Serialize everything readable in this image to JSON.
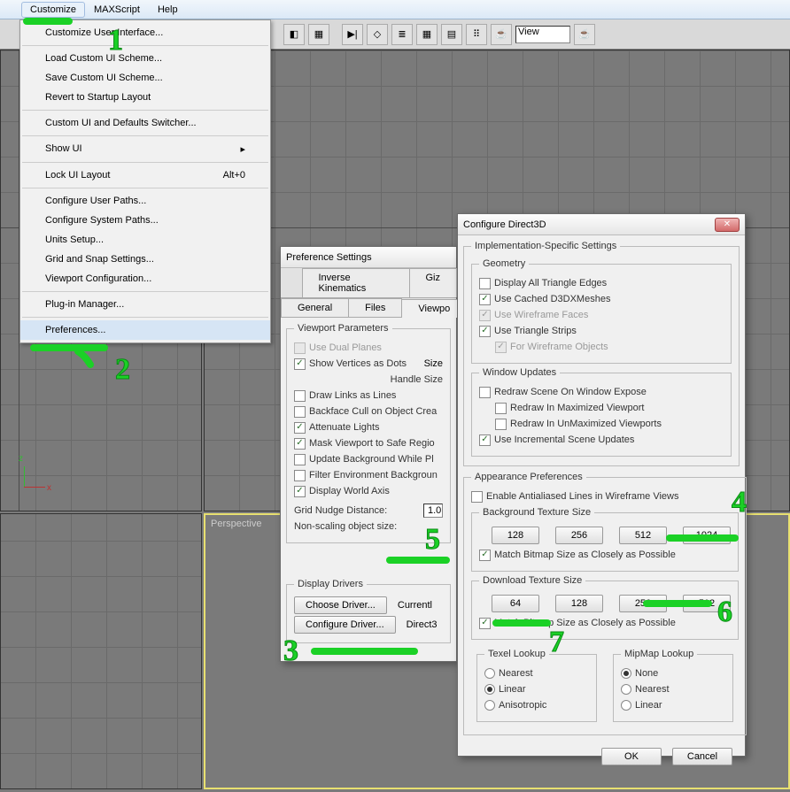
{
  "menubar": {
    "items": [
      "Customize",
      "MAXScript",
      "Help"
    ],
    "open_index": 0
  },
  "toolbar": {
    "view_label": "View"
  },
  "dropdown": {
    "groups": [
      [
        "Customize User Interface..."
      ],
      [
        "Load Custom UI Scheme...",
        "Save Custom UI Scheme...",
        "Revert to Startup Layout"
      ],
      [
        "Custom UI and Defaults Switcher..."
      ],
      [
        "Show UI"
      ],
      [
        "Lock UI Layout"
      ],
      [
        "Configure User Paths...",
        "Configure System Paths...",
        "Units Setup...",
        "Grid and Snap Settings...",
        "Viewport Configuration..."
      ],
      [
        "Plug-in Manager..."
      ],
      [
        "Preferences..."
      ]
    ],
    "show_ui_has_arrow": true,
    "lock_shortcut": "Alt+0",
    "highlight": "Preferences..."
  },
  "viewports": {
    "perspective": "Perspective"
  },
  "pref": {
    "title": "Preference Settings",
    "tabs_row1": [
      "Inverse Kinematics",
      "Giz"
    ],
    "tabs_row2": [
      "General",
      "Files",
      "Viewpo"
    ],
    "vp_params": {
      "legend": "Viewport Parameters",
      "items": [
        {
          "label": "Use Dual Planes",
          "checked": false,
          "disabled": true
        },
        {
          "label": "Show Vertices as Dots",
          "checked": true,
          "extra": "Size"
        },
        {
          "label": "",
          "sub": "Handle Size"
        },
        {
          "label": "Draw Links as Lines",
          "checked": false
        },
        {
          "label": "Backface Cull on Object Crea",
          "checked": false
        },
        {
          "label": "Attenuate Lights",
          "checked": true
        },
        {
          "label": "Mask Viewport to Safe Regio",
          "checked": true
        },
        {
          "label": "Update Background While Pl",
          "checked": false
        },
        {
          "label": "Filter Environment Backgroun",
          "checked": false
        },
        {
          "label": "Display World Axis",
          "checked": true
        }
      ],
      "grid_nudge": "Grid Nudge Distance:",
      "grid_val": "1.0",
      "nonscale": "Non-scaling object size:"
    },
    "drivers": {
      "legend": "Display Drivers",
      "choose": "Choose Driver...",
      "currently": "Currentl",
      "configure": "Configure Driver...",
      "type": "Direct3"
    }
  },
  "d3d": {
    "title": "Configure Direct3D",
    "impl": "Implementation-Specific Settings",
    "geom": {
      "legend": "Geometry",
      "items": [
        {
          "label": "Display All Triangle Edges",
          "checked": false
        },
        {
          "label": "Use Cached D3DXMeshes",
          "checked": true
        },
        {
          "label": "Use Wireframe Faces",
          "checked": true,
          "disabled": true
        },
        {
          "label": "Use Triangle Strips",
          "checked": true
        },
        {
          "label": "For Wireframe Objects",
          "checked": true,
          "disabled": true,
          "indent": true
        }
      ]
    },
    "win": {
      "legend": "Window Updates",
      "items": [
        {
          "label": "Redraw Scene On Window Expose",
          "checked": false
        },
        {
          "label": "Redraw In Maximized Viewport",
          "checked": false,
          "indent": true
        },
        {
          "label": "Redraw In UnMaximized Viewports",
          "checked": false,
          "indent": true
        },
        {
          "label": "Use Incremental Scene Updates",
          "checked": true
        }
      ]
    },
    "appear": {
      "legend": "Appearance Preferences",
      "antialias": {
        "label": "Enable Antialiased Lines in Wireframe Views",
        "checked": false
      },
      "bg": {
        "legend": "Background Texture Size",
        "sizes": [
          "128",
          "256",
          "512",
          "1024"
        ],
        "match": {
          "label": "Match Bitmap Size as Closely as Possible",
          "checked": true
        }
      },
      "dl": {
        "legend": "Download Texture Size",
        "sizes": [
          "64",
          "128",
          "256",
          "512"
        ],
        "match": {
          "label": "Match Bitmap Size as Closely as Possible",
          "checked": true
        }
      },
      "texel": {
        "legend": "Texel Lookup",
        "opts": [
          "Nearest",
          "Linear",
          "Anisotropic"
        ],
        "sel": 1
      },
      "mip": {
        "legend": "MipMap Lookup",
        "opts": [
          "None",
          "Nearest",
          "Linear"
        ],
        "sel": 0
      }
    },
    "ok": "OK",
    "cancel": "Cancel"
  },
  "annot_nums": [
    "1",
    "2",
    "3",
    "4",
    "5",
    "6",
    "7"
  ]
}
